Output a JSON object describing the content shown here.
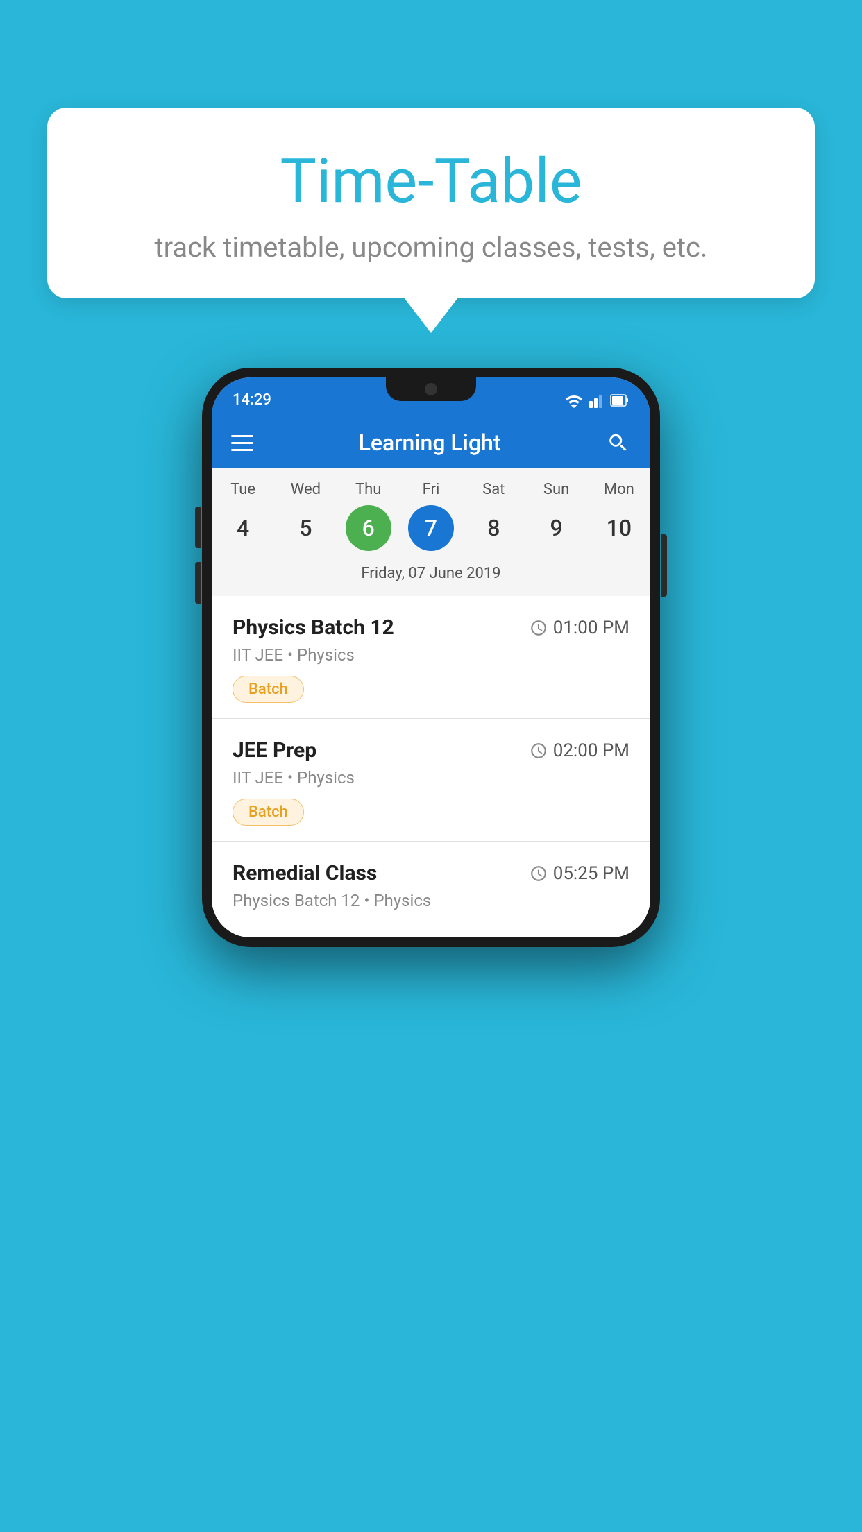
{
  "background_color": "#29B6D8",
  "speech_bubble": {
    "title": "Time-Table",
    "subtitle": "track timetable, upcoming classes, tests, etc."
  },
  "phone": {
    "status_bar": {
      "time": "14:29"
    },
    "app_bar": {
      "title": "Learning Light"
    },
    "calendar": {
      "days": [
        {
          "label": "Tue",
          "num": "4"
        },
        {
          "label": "Wed",
          "num": "5"
        },
        {
          "label": "Thu",
          "num": "6",
          "state": "today"
        },
        {
          "label": "Fri",
          "num": "7",
          "state": "selected"
        },
        {
          "label": "Sat",
          "num": "8"
        },
        {
          "label": "Sun",
          "num": "9"
        },
        {
          "label": "Mon",
          "num": "10"
        }
      ],
      "selected_date": "Friday, 07 June 2019"
    },
    "classes": [
      {
        "name": "Physics Batch 12",
        "time": "01:00 PM",
        "subject": "IIT JEE • Physics",
        "badge": "Batch"
      },
      {
        "name": "JEE Prep",
        "time": "02:00 PM",
        "subject": "IIT JEE • Physics",
        "badge": "Batch"
      },
      {
        "name": "Remedial Class",
        "time": "05:25 PM",
        "subject": "Physics Batch 12 • Physics",
        "badge": ""
      }
    ]
  }
}
